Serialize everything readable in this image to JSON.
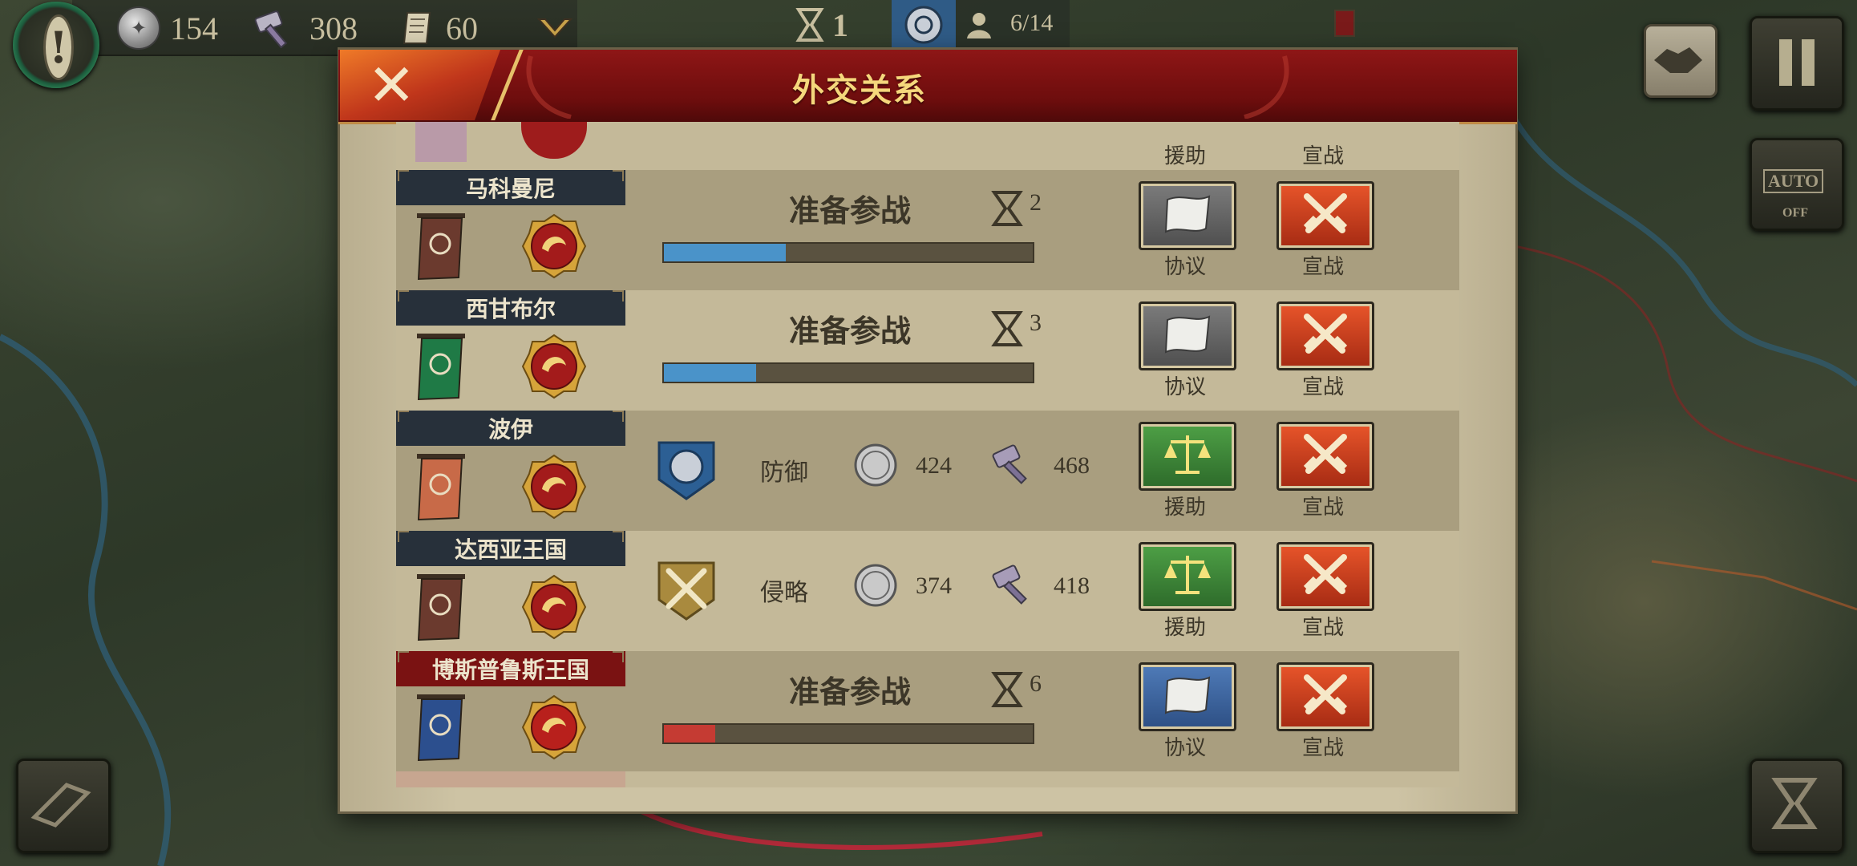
{
  "topbar": {
    "silver": "154",
    "hammer": "308",
    "scroll": "60",
    "turn": "1",
    "population": "6/14"
  },
  "right_buttons": {
    "auto": "AUTO",
    "auto_state": "OFF"
  },
  "dialog": {
    "title": "外交关系",
    "partial_top": {
      "btn1_label": "援助",
      "btn2_label": "宣战"
    },
    "rows": [
      {
        "name": "马科曼尼",
        "kind": "preparing",
        "status": "准备参战",
        "turns": "2",
        "progress": 0.33,
        "bar_color": "#4a93c9",
        "banner_color": "#6b3a2e",
        "btn1_label": "协议",
        "btn2_label": "宣战",
        "btn1_style": "gray"
      },
      {
        "name": "西甘布尔",
        "kind": "preparing",
        "status": "准备参战",
        "turns": "3",
        "progress": 0.25,
        "bar_color": "#4a93c9",
        "banner_color": "#1f7a46",
        "btn1_label": "协议",
        "btn2_label": "宣战",
        "btn1_style": "gray"
      },
      {
        "name": "波伊",
        "kind": "war",
        "stance": "防御",
        "stance_icon": "shield-icon",
        "silver": "424",
        "hammer": "468",
        "banner_color": "#c86a48",
        "btn1_label": "援助",
        "btn2_label": "宣战",
        "btn1_style": "green"
      },
      {
        "name": "达西亚王国",
        "kind": "war",
        "stance": "侵略",
        "stance_icon": "crossed-swords-icon",
        "silver": "374",
        "hammer": "418",
        "banner_color": "#6b3a2e",
        "btn1_label": "援助",
        "btn2_label": "宣战",
        "btn1_style": "green"
      },
      {
        "name": "博斯普鲁斯王国",
        "kind": "preparing",
        "enemy": true,
        "status": "准备参战",
        "turns": "6",
        "progress": 0.14,
        "bar_color": "#c53b33",
        "banner_color": "#2c4f8e",
        "btn1_label": "协议",
        "btn2_label": "宣战",
        "btn1_style": "blue"
      }
    ]
  }
}
